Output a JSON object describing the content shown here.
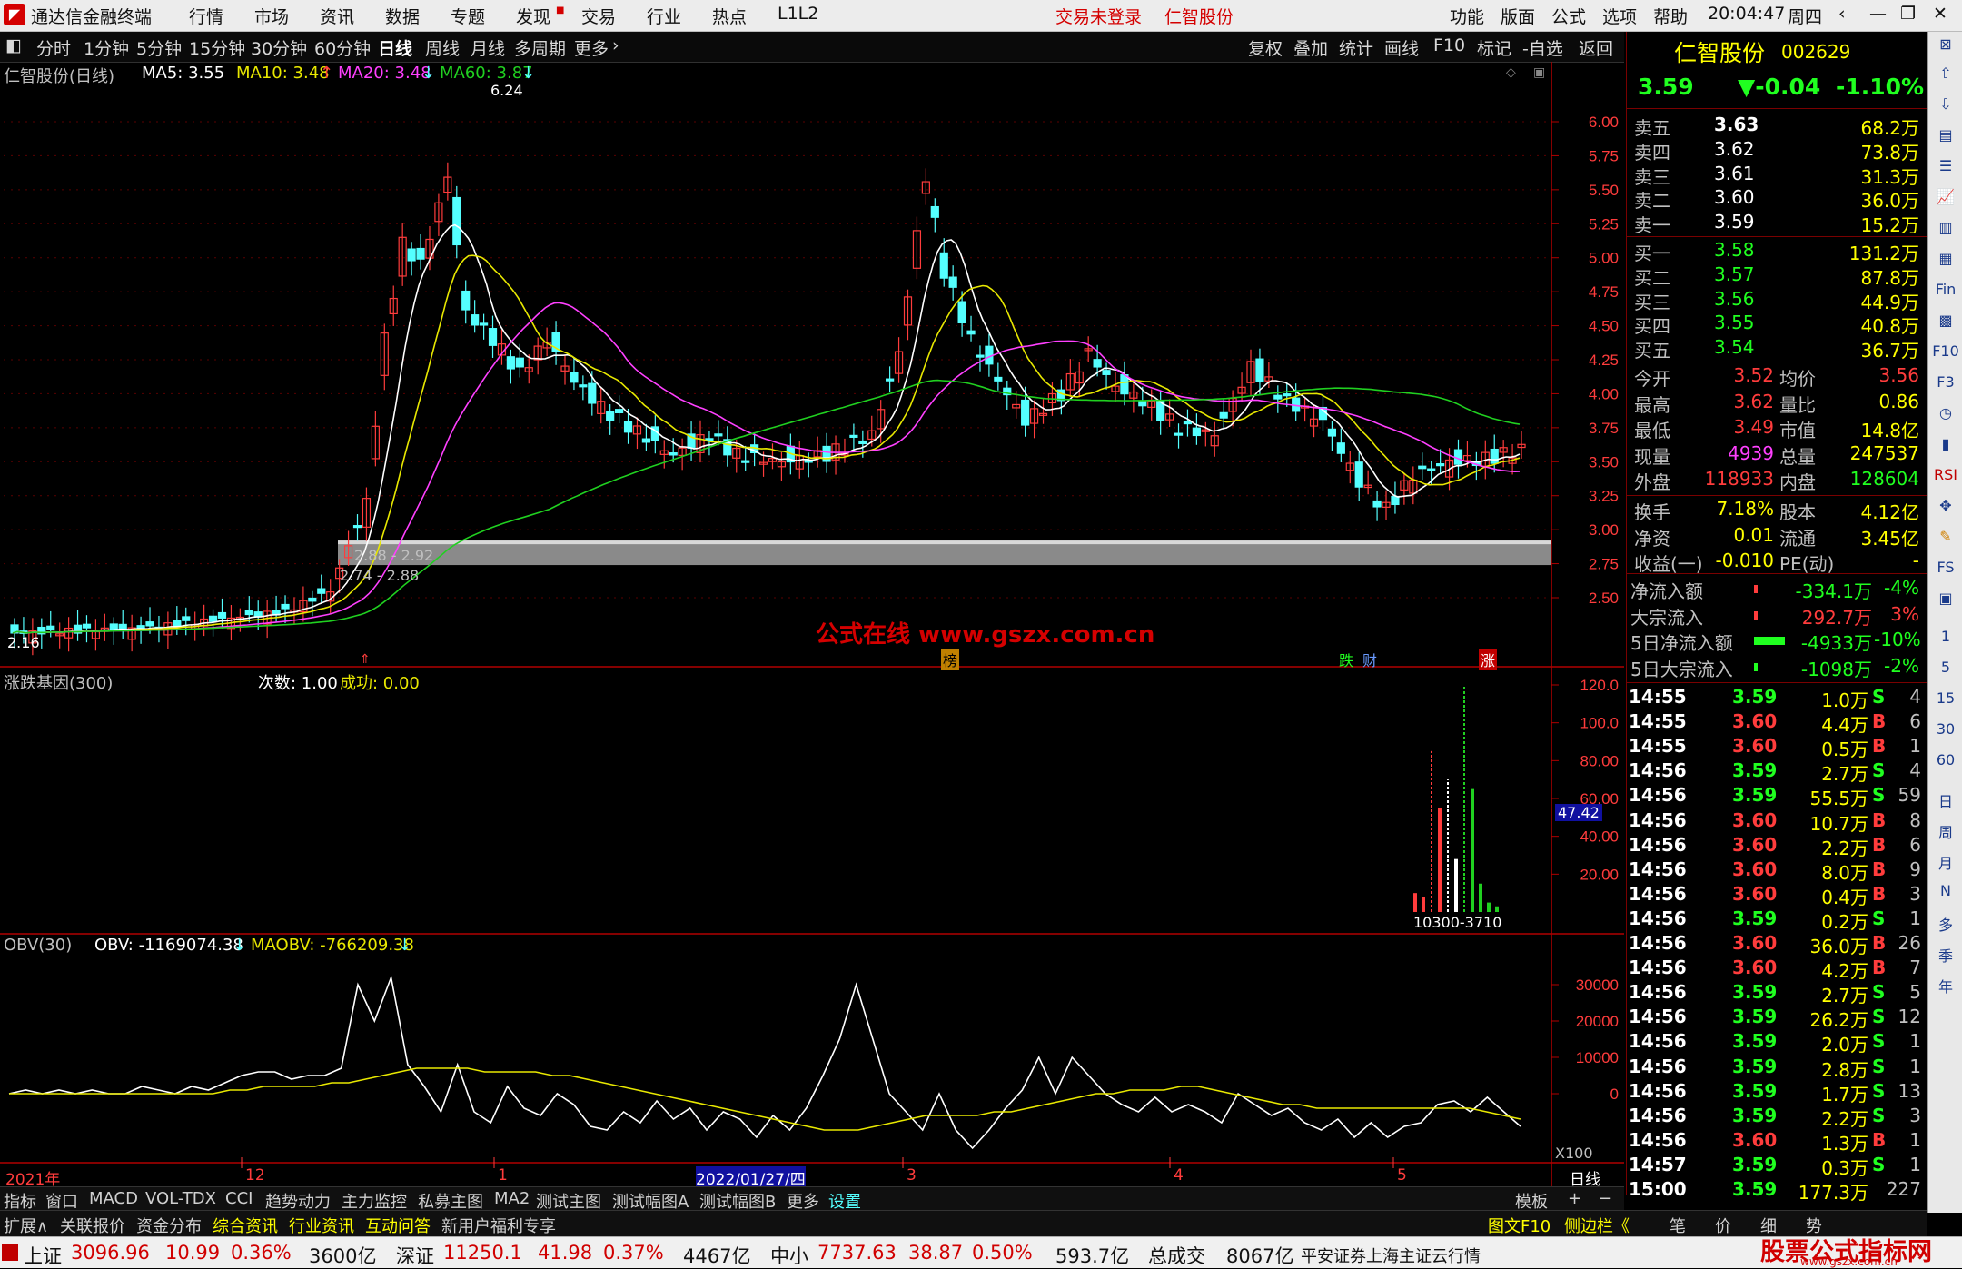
{
  "titlebar": {
    "app_name": "通达信金融终端",
    "menus": [
      "行情",
      "市场",
      "资讯",
      "数据",
      "专题",
      "发现",
      "交易",
      "行业",
      "热点",
      "L1L2"
    ],
    "login_status": "交易未登录",
    "stock_name": "仁智股份",
    "right_menus": [
      "功能",
      "版面",
      "公式",
      "选项",
      "帮助"
    ],
    "time": "20:04:47",
    "weekday": "周四"
  },
  "toolbar": {
    "periods": [
      "分时",
      "1分钟",
      "5分钟",
      "15分钟",
      "30分钟",
      "60分钟",
      "日线",
      "周线",
      "月线",
      "多周期",
      "更多"
    ],
    "active_period": "日线",
    "right_buttons": [
      "复权",
      "叠加",
      "统计",
      "画线",
      "F10",
      "标记",
      "-自选",
      "返回"
    ]
  },
  "main_chart": {
    "title": "仁智股份(日线)",
    "ma5_label": "MA5: 3.55",
    "ma10_label": "MA10: 3.48",
    "ma20_label": "MA20: 3.48",
    "ma60_label": "MA60: 3.87",
    "high_label": "6.24",
    "low_label": "2.16",
    "band_label1": "2.88 - 2.92",
    "band_label2": "2.74 - 2.88",
    "watermark": "公式在线 www.gszx.com.cn",
    "event_labels": [
      "榜",
      "跌",
      "财",
      "涨"
    ],
    "y_ticks": [
      "6.00",
      "5.75",
      "5.50",
      "5.25",
      "5.00",
      "4.75",
      "4.50",
      "4.25",
      "4.00",
      "3.75",
      "3.50",
      "3.25",
      "3.00",
      "2.75",
      "2.50"
    ],
    "colors": {
      "up": "#ff3c3c",
      "down": "#54ffff",
      "ma5": "#ffffff",
      "ma10": "#e8e800",
      "ma20": "#ff40ff",
      "ma60": "#20d020"
    }
  },
  "sub1": {
    "title": "涨跌基因(300)",
    "count_label": "次数: 1.00",
    "success_label": "成功: 0.00",
    "y_ticks": [
      "120.0",
      "100.0",
      "80.00",
      "60.00",
      "40.00",
      "20.00"
    ],
    "current_value": "47.42",
    "bottom_digits": "10300-3710",
    "bars": [
      {
        "v": 10,
        "c": "#ff3c3c"
      },
      {
        "v": 8,
        "c": "#ff3c3c"
      },
      {
        "v": 85,
        "c": "#ff3c3c",
        "dash": true
      },
      {
        "v": 55,
        "c": "#ff3c3c"
      },
      {
        "v": 70,
        "c": "#ffffff",
        "dash": true
      },
      {
        "v": 28,
        "c": "#ffffff"
      },
      {
        "v": 120,
        "c": "#20d020",
        "dash": true
      },
      {
        "v": 65,
        "c": "#20d020"
      },
      {
        "v": 15,
        "c": "#20d020"
      },
      {
        "v": 5,
        "c": "#20d020"
      },
      {
        "v": 3,
        "c": "#20d020"
      }
    ]
  },
  "sub2": {
    "title": "OBV(30)",
    "obv_label": "OBV: -1169074.38",
    "maobv_label": "MAOBV: -766209.38",
    "y_ticks": [
      "30000",
      "20000",
      "10000",
      "0"
    ],
    "multiplier": "X100",
    "chart_data": {
      "type": "line",
      "series": [
        {
          "name": "OBV",
          "values": [
            0,
            1,
            0,
            1,
            0,
            1,
            0,
            0,
            2,
            1,
            0,
            2,
            1,
            3,
            5,
            6,
            6,
            4,
            5,
            5,
            7,
            30,
            20,
            32,
            8,
            2,
            -5,
            8,
            -5,
            -8,
            2,
            -4,
            -6,
            0,
            -3,
            -9,
            -10,
            -5,
            -8,
            -2,
            -7,
            -4,
            -10,
            -5,
            -7,
            -12,
            -6,
            -10,
            -4,
            5,
            15,
            30,
            15,
            0,
            -5,
            -10,
            0,
            -10,
            -15,
            -10,
            -4,
            1,
            10,
            0,
            10,
            5,
            0,
            -3,
            -5,
            -1,
            -5,
            -3,
            -5,
            -8,
            0,
            -3,
            -6,
            -4,
            -8,
            -10,
            -7,
            -12,
            -8,
            -12,
            -9,
            -8,
            -3,
            -2,
            -5,
            -1,
            -5,
            -9
          ]
        },
        {
          "name": "MAOBV",
          "values": [
            0,
            0,
            0,
            0,
            0,
            0,
            0,
            0,
            0,
            0,
            0,
            0,
            0,
            1,
            1,
            2,
            2,
            2,
            2,
            3,
            3,
            4,
            5,
            6,
            7,
            7,
            7,
            7,
            6,
            6,
            6,
            6,
            5,
            5,
            4,
            3,
            2,
            1,
            0,
            -1,
            -2,
            -3,
            -4,
            -5,
            -6,
            -7,
            -8,
            -9,
            -10,
            -10,
            -10,
            -9,
            -8,
            -7,
            -6,
            -6,
            -6,
            -6,
            -5,
            -5,
            -4,
            -3,
            -2,
            -1,
            0,
            0,
            1,
            1,
            1,
            2,
            2,
            1,
            0,
            -1,
            -2,
            -3,
            -3,
            -4,
            -4,
            -4,
            -4,
            -4,
            -4,
            -4,
            -4,
            -4,
            -4,
            -5,
            -6,
            -7
          ]
        }
      ]
    }
  },
  "xaxis": {
    "labels": [
      "2021年",
      "12",
      "1",
      "2022/01/27/四",
      "3",
      "4",
      "5"
    ],
    "period_label": "日线"
  },
  "bottom_tabs": [
    "指标",
    "窗口",
    "MACD",
    "VOL-TDX",
    "CCI",
    "趋势动力",
    "主力监控",
    "私募主图",
    "MA2",
    "测试主图",
    "测试幅图A",
    "测试幅图B",
    "更多",
    "设置"
  ],
  "template_label": "模板",
  "bottom_tabs2": [
    "扩展∧",
    "关联报价",
    "资金分布",
    "综合资讯",
    "行业资讯",
    "互动问答",
    "新用户福利专享"
  ],
  "quote": {
    "name": "仁智股份",
    "code": "002629",
    "price": "3.59",
    "change": "▼-0.04",
    "pct": "-1.10%",
    "asks": [
      {
        "label": "卖五",
        "price": "3.63",
        "vol": "68.2万"
      },
      {
        "label": "卖四",
        "price": "3.62",
        "vol": "73.8万"
      },
      {
        "label": "卖三",
        "price": "3.61",
        "vol": "31.3万"
      },
      {
        "label": "卖二",
        "price": "3.60",
        "vol": "36.0万"
      },
      {
        "label": "卖一",
        "price": "3.59",
        "vol": "15.2万"
      }
    ],
    "bids": [
      {
        "label": "买一",
        "price": "3.58",
        "vol": "131.2万"
      },
      {
        "label": "买二",
        "price": "3.57",
        "vol": "87.8万"
      },
      {
        "label": "买三",
        "price": "3.56",
        "vol": "44.9万"
      },
      {
        "label": "买四",
        "price": "3.55",
        "vol": "40.8万"
      },
      {
        "label": "买五",
        "price": "3.54",
        "vol": "36.7万"
      }
    ],
    "stats": [
      {
        "l1": "今开",
        "v1": "3.52",
        "c1": "#ff3c3c",
        "l2": "均价",
        "v2": "3.56",
        "c2": "#ff3c3c"
      },
      {
        "l1": "最高",
        "v1": "3.62",
        "c1": "#ff3c3c",
        "l2": "量比",
        "v2": "0.86",
        "c2": "#ffff00"
      },
      {
        "l1": "最低",
        "v1": "3.49",
        "c1": "#ff3c3c",
        "l2": "市值",
        "v2": "14.8亿",
        "c2": "#ffff00"
      },
      {
        "l1": "现量",
        "v1": "4939",
        "c1": "#ff40ff",
        "l2": "总量",
        "v2": "247537",
        "c2": "#ffff00"
      },
      {
        "l1": "外盘",
        "v1": "118933",
        "c1": "#ff3c3c",
        "l2": "内盘",
        "v2": "128604",
        "c2": "#20ff20"
      },
      {
        "l1": "换手",
        "v1": "7.18%",
        "c1": "#ffff00",
        "l2": "股本",
        "v2": "4.12亿",
        "c2": "#ffff00"
      },
      {
        "l1": "净资",
        "v1": "0.01",
        "c1": "#ffff00",
        "l2": "流通",
        "v2": "3.45亿",
        "c2": "#ffff00"
      },
      {
        "l1": "收益(一)",
        "v1": "-0.010",
        "c1": "#ffff00",
        "l2": "PE(动)",
        "v2": "-",
        "c2": "#ffff00"
      }
    ],
    "flows": [
      {
        "label": "净流入额",
        "value": "-334.1万",
        "pct": "-4%",
        "c": "#20ff20",
        "bar": "small-red"
      },
      {
        "label": "大宗流入",
        "value": "292.7万",
        "pct": "3%",
        "c": "#ff3c3c",
        "bar": "small-red"
      },
      {
        "label": "5日净流入额",
        "value": "-4933万",
        "pct": "-10%",
        "c": "#20ff20",
        "bar": "big-green"
      },
      {
        "label": "5日大宗流入",
        "value": "-1098万",
        "pct": "-2%",
        "c": "#20ff20",
        "bar": "small-green"
      }
    ],
    "ticks": [
      {
        "t": "14:55",
        "p": "3.59",
        "v": "1.0万",
        "s": "S",
        "n": "4"
      },
      {
        "t": "14:55",
        "p": "3.60",
        "v": "4.4万",
        "s": "B",
        "n": "6"
      },
      {
        "t": "14:55",
        "p": "3.60",
        "v": "0.5万",
        "s": "B",
        "n": "1"
      },
      {
        "t": "14:56",
        "p": "3.59",
        "v": "2.7万",
        "s": "S",
        "n": "4"
      },
      {
        "t": "14:56",
        "p": "3.59",
        "v": "55.5万",
        "s": "S",
        "n": "59"
      },
      {
        "t": "14:56",
        "p": "3.60",
        "v": "10.7万",
        "s": "B",
        "n": "8"
      },
      {
        "t": "14:56",
        "p": "3.60",
        "v": "2.2万",
        "s": "B",
        "n": "6"
      },
      {
        "t": "14:56",
        "p": "3.60",
        "v": "8.0万",
        "s": "B",
        "n": "9"
      },
      {
        "t": "14:56",
        "p": "3.60",
        "v": "0.4万",
        "s": "B",
        "n": "3"
      },
      {
        "t": "14:56",
        "p": "3.59",
        "v": "0.2万",
        "s": "S",
        "n": "1"
      },
      {
        "t": "14:56",
        "p": "3.60",
        "v": "36.0万",
        "s": "B",
        "n": "26"
      },
      {
        "t": "14:56",
        "p": "3.60",
        "v": "4.2万",
        "s": "B",
        "n": "7"
      },
      {
        "t": "14:56",
        "p": "3.59",
        "v": "2.7万",
        "s": "S",
        "n": "5"
      },
      {
        "t": "14:56",
        "p": "3.59",
        "v": "26.2万",
        "s": "S",
        "n": "12"
      },
      {
        "t": "14:56",
        "p": "3.59",
        "v": "2.0万",
        "s": "S",
        "n": "1"
      },
      {
        "t": "14:56",
        "p": "3.59",
        "v": "2.8万",
        "s": "S",
        "n": "1"
      },
      {
        "t": "14:56",
        "p": "3.59",
        "v": "1.7万",
        "s": "S",
        "n": "13"
      },
      {
        "t": "14:56",
        "p": "3.59",
        "v": "2.2万",
        "s": "S",
        "n": "3"
      },
      {
        "t": "14:56",
        "p": "3.60",
        "v": "1.3万",
        "s": "B",
        "n": "1"
      },
      {
        "t": "14:57",
        "p": "3.59",
        "v": "0.3万",
        "s": "S",
        "n": "1"
      },
      {
        "t": "15:00",
        "p": "3.59",
        "v": "177.3万",
        "s": "",
        "n": "227"
      }
    ],
    "bottom_buttons": [
      "图文F10",
      "侧边栏《",
      "笔",
      "价",
      "细",
      "势"
    ]
  },
  "sidebar_labels": [
    "1",
    "5",
    "15",
    "30",
    "60",
    "日",
    "周",
    "月",
    "N",
    "多",
    "季",
    "年"
  ],
  "statusbar": {
    "items": [
      {
        "name": "上证",
        "val": "3096.96",
        "chg": "10.99",
        "pct": "0.36%",
        "amt": "3600亿"
      },
      {
        "name": "深证",
        "val": "11250.1",
        "chg": "41.98",
        "pct": "0.37%",
        "amt": "4467亿"
      },
      {
        "name": "中小",
        "val": "7737.63",
        "chg": "38.87",
        "pct": "0.50%",
        "amt": "593.7亿"
      }
    ],
    "total_label": "总成交",
    "total_value": "8067亿",
    "broker": "平安证券上海主证云行情",
    "brand": "股票公式指标网",
    "brand_url": "www.gszx.com.cn"
  }
}
